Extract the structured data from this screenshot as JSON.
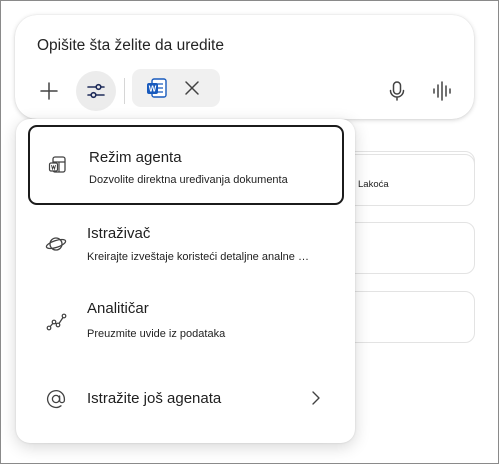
{
  "composer": {
    "input_text": "Opišite šta želite da uredite"
  },
  "attachment_chip": {
    "icon": "word-document-icon"
  },
  "background_cards": [
    {
      "label": ""
    },
    {
      "label": "Lakoća"
    },
    {
      "label": ""
    },
    {
      "label": ""
    }
  ],
  "menu": {
    "items": [
      {
        "title": "Režim agenta",
        "description": "Dozvolite direktna uređivanja dokumenta",
        "icon": "agent-document-icon",
        "selected": true
      },
      {
        "title": "Istraživač",
        "description": "Kreirajte izveštaje koristeći detaljne analne …",
        "icon": "planet-icon"
      },
      {
        "title": "Analitičar",
        "description": "Preuzmite uvide iz podataka",
        "icon": "trend-line-icon"
      },
      {
        "title": "Istražite još agenata",
        "icon": "at-sign-icon"
      }
    ]
  },
  "colors": {
    "selected_border": "#1b1b1b",
    "tools_active_bg": "#ececec",
    "word_blue": "#185abd"
  }
}
